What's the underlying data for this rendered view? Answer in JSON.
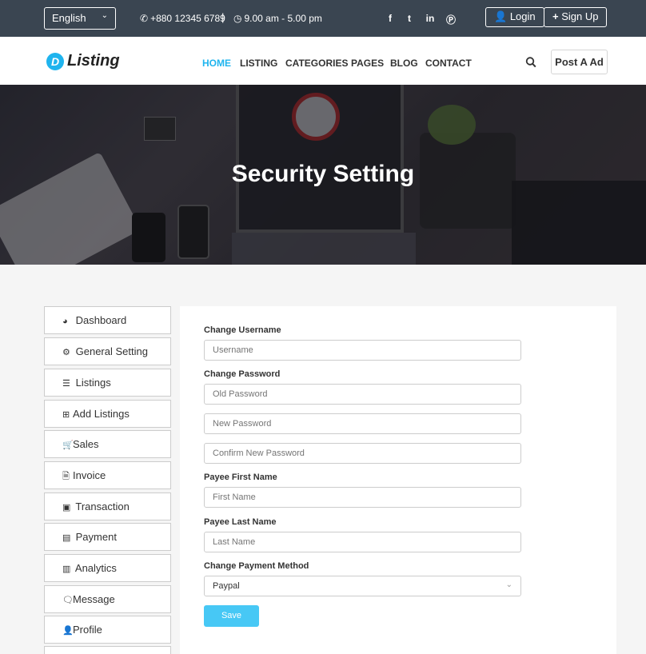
{
  "topbar": {
    "language": "English",
    "phone": "+880 12345 6789",
    "separator": "|",
    "hours": "9.00 am - 5.00 pm",
    "social": [
      "facebook-icon",
      "twitter-icon",
      "linkedin-icon",
      "pinterest-icon"
    ],
    "login_label": "Login",
    "signup_label": "Sign Up"
  },
  "header": {
    "logo_mark": "D",
    "logo_text": "Listing",
    "nav": [
      "HOME",
      "LISTING",
      "CATEGORIES",
      "PAGES",
      "BLOG",
      "CONTACT"
    ],
    "active_nav": "HOME",
    "post_ad_label": "Post A Ad"
  },
  "hero": {
    "title": "Security Setting"
  },
  "sidebar": {
    "items": [
      {
        "label": "Dashboard",
        "icon": "dashboard-icon"
      },
      {
        "label": "General Setting",
        "icon": "gear-icon"
      },
      {
        "label": "Listings",
        "icon": "list-icon"
      },
      {
        "label": "Add Listings",
        "icon": "plus-square-icon"
      },
      {
        "label": "Sales",
        "icon": "cart-icon"
      },
      {
        "label": "Invoice",
        "icon": "file-icon"
      },
      {
        "label": "Transaction",
        "icon": "money-icon"
      },
      {
        "label": "Payment",
        "icon": "credit-card-icon"
      },
      {
        "label": "Analytics",
        "icon": "bar-chart-icon"
      },
      {
        "label": "Message",
        "icon": "comment-icon"
      },
      {
        "label": "Profile",
        "icon": "user-icon"
      }
    ]
  },
  "form": {
    "username_label": "Change Username",
    "username_placeholder": "Username",
    "password_label": "Change Password",
    "old_password_placeholder": "Old Password",
    "new_password_placeholder": "New Password",
    "confirm_password_placeholder": "Confirm New Password",
    "payee_first_label": "Payee First Name",
    "payee_first_placeholder": "First Name",
    "payee_last_label": "Payee Last Name",
    "payee_last_placeholder": "Last Name",
    "payment_method_label": "Change Payment Method",
    "payment_method_value": "Paypal",
    "save_label": "Save"
  },
  "colors": {
    "topbar_bg": "#3a4551",
    "accent": "#1fb4ee",
    "save_button": "#47c8f5",
    "page_bg": "#f5f5f5"
  }
}
